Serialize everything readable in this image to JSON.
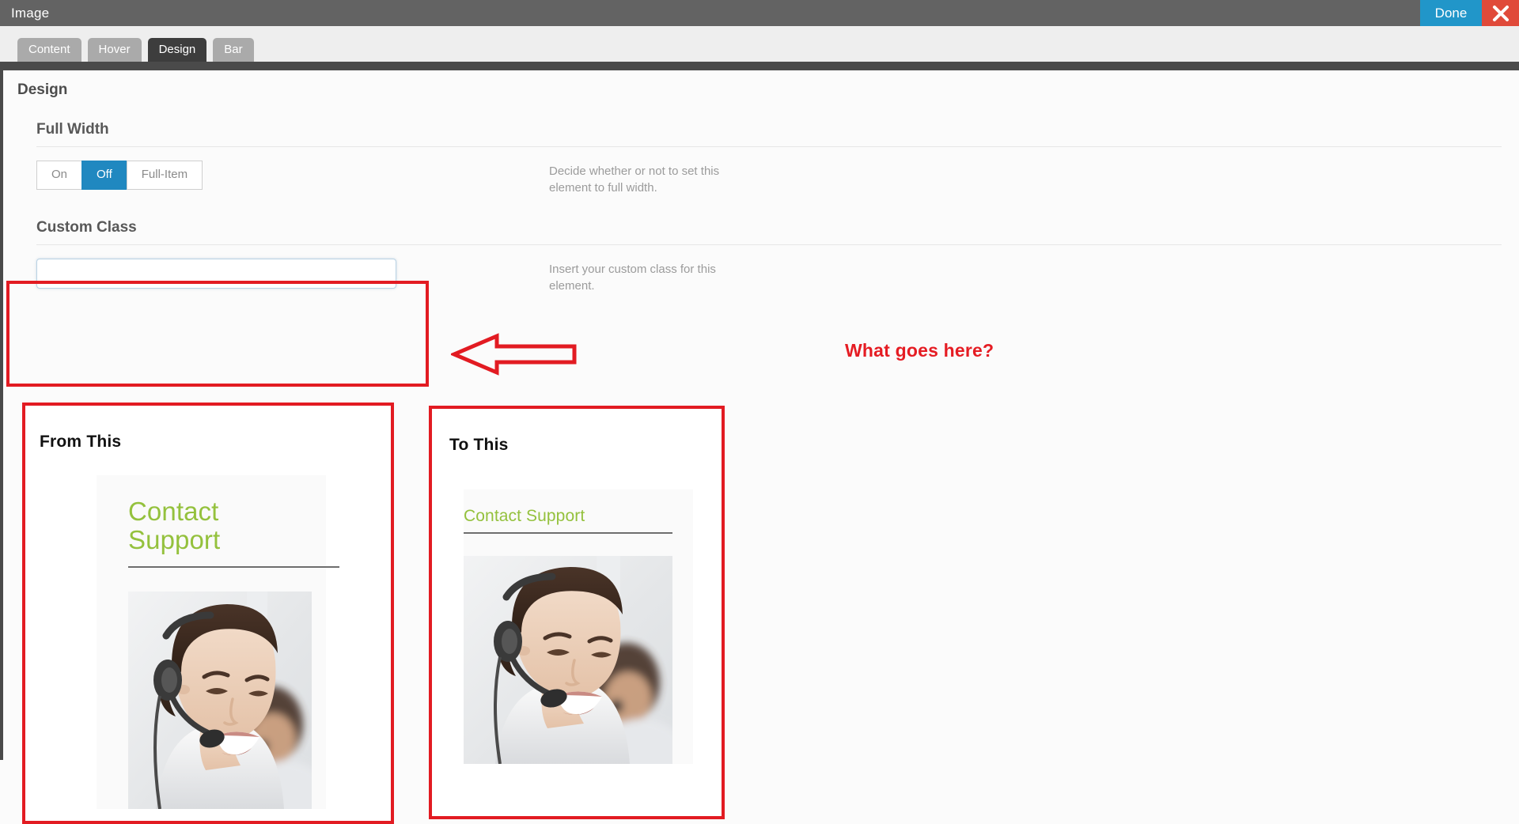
{
  "titlebar": {
    "title": "Image",
    "done_label": "Done",
    "close_icon": "close-icon"
  },
  "tabs": [
    {
      "label": "Content",
      "active": false
    },
    {
      "label": "Hover",
      "active": false
    },
    {
      "label": "Design",
      "active": true
    },
    {
      "label": "Bar",
      "active": false
    }
  ],
  "panel": {
    "title": "Design"
  },
  "sections": {
    "full_width": {
      "heading": "Full Width",
      "options": [
        {
          "label": "On",
          "selected": false
        },
        {
          "label": "Off",
          "selected": true
        },
        {
          "label": "Full-Item",
          "selected": false
        }
      ],
      "description": "Decide whether or not to set this element to full width."
    },
    "custom_class": {
      "heading": "Custom Class",
      "input_value": "",
      "input_placeholder": "",
      "description": "Insert your custom class for this element."
    }
  },
  "annotations": {
    "callout_text": "What goes here?",
    "arrow_icon": "left-arrow-icon",
    "highlight_color": "#e21b22",
    "callout_color": "#e51c23"
  },
  "compare": {
    "from": {
      "label": "From This",
      "widget_title": "Contact Support",
      "photo_alt": "headset-support-agent-photo"
    },
    "to": {
      "label": "To This",
      "widget_title": "Contact Support",
      "photo_alt": "headset-support-agent-photo"
    },
    "accent_color": "#94c13d"
  }
}
